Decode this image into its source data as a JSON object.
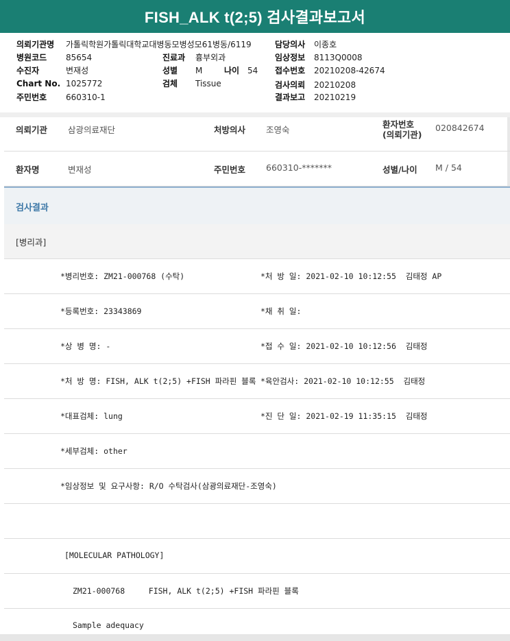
{
  "title": "FISH_ALK t(2;5) 검사결과보고서",
  "info": {
    "req_institution_label": "의뢰기관명",
    "req_institution_value": "가톨릭학원가톨릭대학교대병동모병성모61병동/6119",
    "hospital_code_label": "병원코드",
    "hospital_code_value": "85654",
    "recipient_label": "수진자",
    "recipient_value": "변재성",
    "chart_no_label": "Chart No.",
    "chart_no_value": "1025772",
    "resident_no_label": "주민번호",
    "resident_no_value": "660310-1",
    "dept_label": "진료과",
    "dept_value": "흉부외과",
    "sex_label": "성별",
    "sex_value": "M",
    "age_label": "나이",
    "age_value": "54",
    "specimen_label": "검체",
    "specimen_value": "Tissue",
    "doctor_label": "담당의사",
    "doctor_value": "이종호",
    "clinical_label": "임상정보",
    "clinical_value": "8113Q0008",
    "receipt_label": "접수번호",
    "receipt_value": "20210208-42674",
    "request_label": "검사의뢰",
    "request_value": "20210208",
    "report_label": "결과보고",
    "report_value": "20210219"
  },
  "header_rows": {
    "institution_label": "의뢰기관",
    "institution_value": "삼광의료재단",
    "prescriber_label": "처방의사",
    "prescriber_value": "조영숙",
    "patient_no_label_1": "환자번호",
    "patient_no_label_2": "(의뢰기관)",
    "patient_no_value": "020842674",
    "patient_name_label": "환자명",
    "patient_name_value": "변재성",
    "resident_label": "주민번호",
    "resident_value": "660310-*******",
    "sex_age_label": "성별/나이",
    "sex_age_value": "M / 54"
  },
  "section_title": "검사결과",
  "department": "[병리과]",
  "rows": [
    {
      "left": "*병리번호: ZM21-000768 (수탁)",
      "right": "*처 방 일: 2021-02-10 10:12:55  김태정 AP"
    },
    {
      "left": "*등록번호: 23343869",
      "right": "*채 취 일:"
    },
    {
      "left": "*상 병 명: -",
      "right": "*접 수 일: 2021-02-10 10:12:56  김태정"
    },
    {
      "left": "*처 방 명: FISH, ALK t(2;5) +FISH 파라핀 블록",
      "right": "*육안검사: 2021-02-10 10:12:55  김태정"
    },
    {
      "left": "*대표검체: lung",
      "right": "*진 단 일: 2021-02-19 11:35:15  김태정"
    },
    {
      "left": "*세부검체: other",
      "right": ""
    },
    {
      "left": "*임상정보 및 요구사항: R/O 수탁검사(삼광의료재단-조영숙)",
      "right": ""
    }
  ],
  "report_lines": [
    "[MOLECULAR PATHOLOGY]",
    "ZM21-000768     FISH, ALK t(2;5) +FISH 파라핀 블록",
    "Sample adequacy"
  ]
}
